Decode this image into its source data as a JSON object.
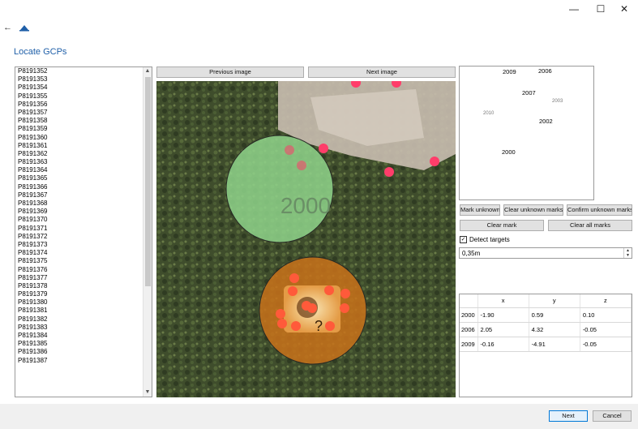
{
  "window": {
    "minimize": "—",
    "maximize": "☐",
    "close": "✕"
  },
  "toolbar": {
    "back": "←"
  },
  "page_title": "Locate GCPs",
  "images": [
    "P8191352",
    "P8191353",
    "P8191354",
    "P8191355",
    "P8191356",
    "P8191357",
    "P8191358",
    "P8191359",
    "P8191360",
    "P8191361",
    "P8191362",
    "P8191363",
    "P8191364",
    "P8191365",
    "P8191366",
    "P8191367",
    "P8191368",
    "P8191369",
    "P8191370",
    "P8191371",
    "P8191372",
    "P8191373",
    "P8191374",
    "P8191375",
    "P8191376",
    "P8191377",
    "P8191378",
    "P8191379",
    "P8191380",
    "P8191381",
    "P8191382",
    "P8191383",
    "P8191384",
    "P8191385",
    "P8191386",
    "P8191387"
  ],
  "nav": {
    "previous": "Previous image",
    "next": "Next image"
  },
  "image_view": {
    "marker_label": "2000",
    "unknown_label": "?"
  },
  "overview": {
    "labels": [
      {
        "text": "2009",
        "small": false
      },
      {
        "text": "2006",
        "small": false
      },
      {
        "text": "2007",
        "small": false
      },
      {
        "text": "2003",
        "small": true
      },
      {
        "text": "2010",
        "small": true
      },
      {
        "text": "2002",
        "small": false
      },
      {
        "text": "2000",
        "small": false
      }
    ]
  },
  "actions": {
    "mark_unknown": "Mark unknown",
    "clear_unknown": "Clear unknown marks",
    "confirm_unknown": "Confirm unknown marks",
    "clear_mark": "Clear mark",
    "clear_all": "Clear all marks"
  },
  "detect": {
    "label": "Detect targets",
    "checked": true,
    "check_glyph": "✓"
  },
  "spin": {
    "value": "0,35m",
    "up": "▲",
    "down": "▼"
  },
  "coords": {
    "headers": [
      "",
      "x",
      "y",
      "z"
    ],
    "rows": [
      [
        "2000",
        "-1.90",
        "0.59",
        "0.10"
      ],
      [
        "2006",
        "2.05",
        "4.32",
        "-0.05"
      ],
      [
        "2009",
        "-0.16",
        "-4.91",
        "-0.05"
      ]
    ]
  },
  "footer": {
    "next": "Next",
    "cancel": "Cancel"
  },
  "colors": {
    "accent": "#1f5fa8",
    "marker_known": "#8fd48a",
    "marker_unknown": "#c9721a",
    "detection": "#ff3d6a"
  }
}
